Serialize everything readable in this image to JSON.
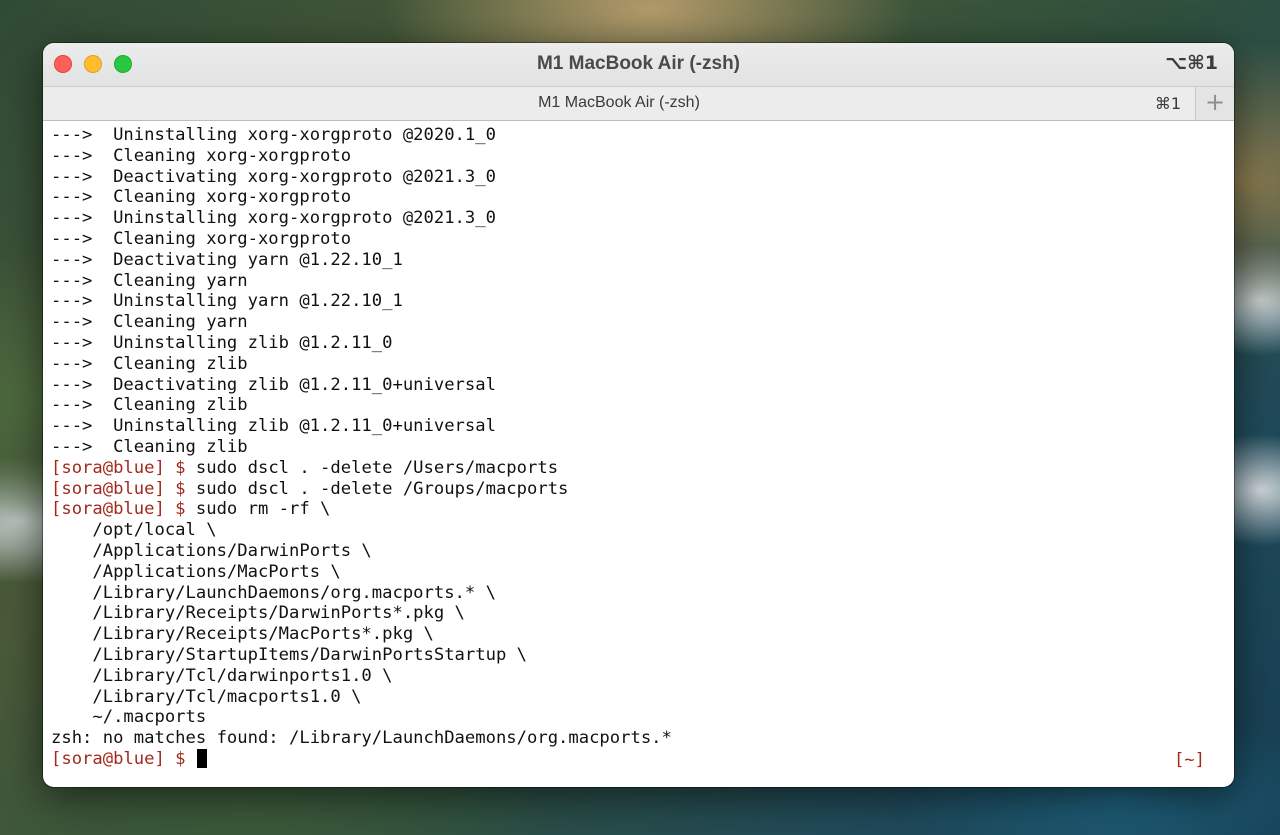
{
  "window": {
    "title": "M1 MacBook Air (-zsh)",
    "shortcut": "⌥⌘1"
  },
  "tab": {
    "title": "M1 MacBook Air (-zsh)",
    "shortcut": "⌘1",
    "new_tab_glyph": "+"
  },
  "terminal": {
    "output_lines": [
      "--->  Uninstalling xorg-xorgproto @2020.1_0",
      "--->  Cleaning xorg-xorgproto",
      "--->  Deactivating xorg-xorgproto @2021.3_0",
      "--->  Cleaning xorg-xorgproto",
      "--->  Uninstalling xorg-xorgproto @2021.3_0",
      "--->  Cleaning xorg-xorgproto",
      "--->  Deactivating yarn @1.22.10_1",
      "--->  Cleaning yarn",
      "--->  Uninstalling yarn @1.22.10_1",
      "--->  Cleaning yarn",
      "--->  Uninstalling zlib @1.2.11_0",
      "--->  Cleaning zlib",
      "--->  Deactivating zlib @1.2.11_0+universal",
      "--->  Cleaning zlib",
      "--->  Uninstalling zlib @1.2.11_0+universal",
      "--->  Cleaning zlib"
    ],
    "prompt": "[sora@blue] $",
    "commands": [
      " sudo dscl . -delete /Users/macports",
      " sudo dscl . -delete /Groups/macports",
      " sudo rm -rf \\"
    ],
    "continuation_lines": [
      "    /opt/local \\",
      "    /Applications/DarwinPorts \\",
      "    /Applications/MacPorts \\",
      "    /Library/LaunchDaemons/org.macports.* \\",
      "    /Library/Receipts/DarwinPorts*.pkg \\",
      "    /Library/Receipts/MacPorts*.pkg \\",
      "    /Library/StartupItems/DarwinPortsStartup \\",
      "    /Library/Tcl/darwinports1.0 \\",
      "    /Library/Tcl/macports1.0 \\",
      "    ~/.macports"
    ],
    "error_line": "zsh: no matches found: /Library/LaunchDaemons/org.macports.*",
    "current_input": "",
    "right_prompt": "[~]",
    "colors": {
      "prompt": "#a4281c",
      "text": "#111111",
      "background": "#ffffff"
    }
  }
}
